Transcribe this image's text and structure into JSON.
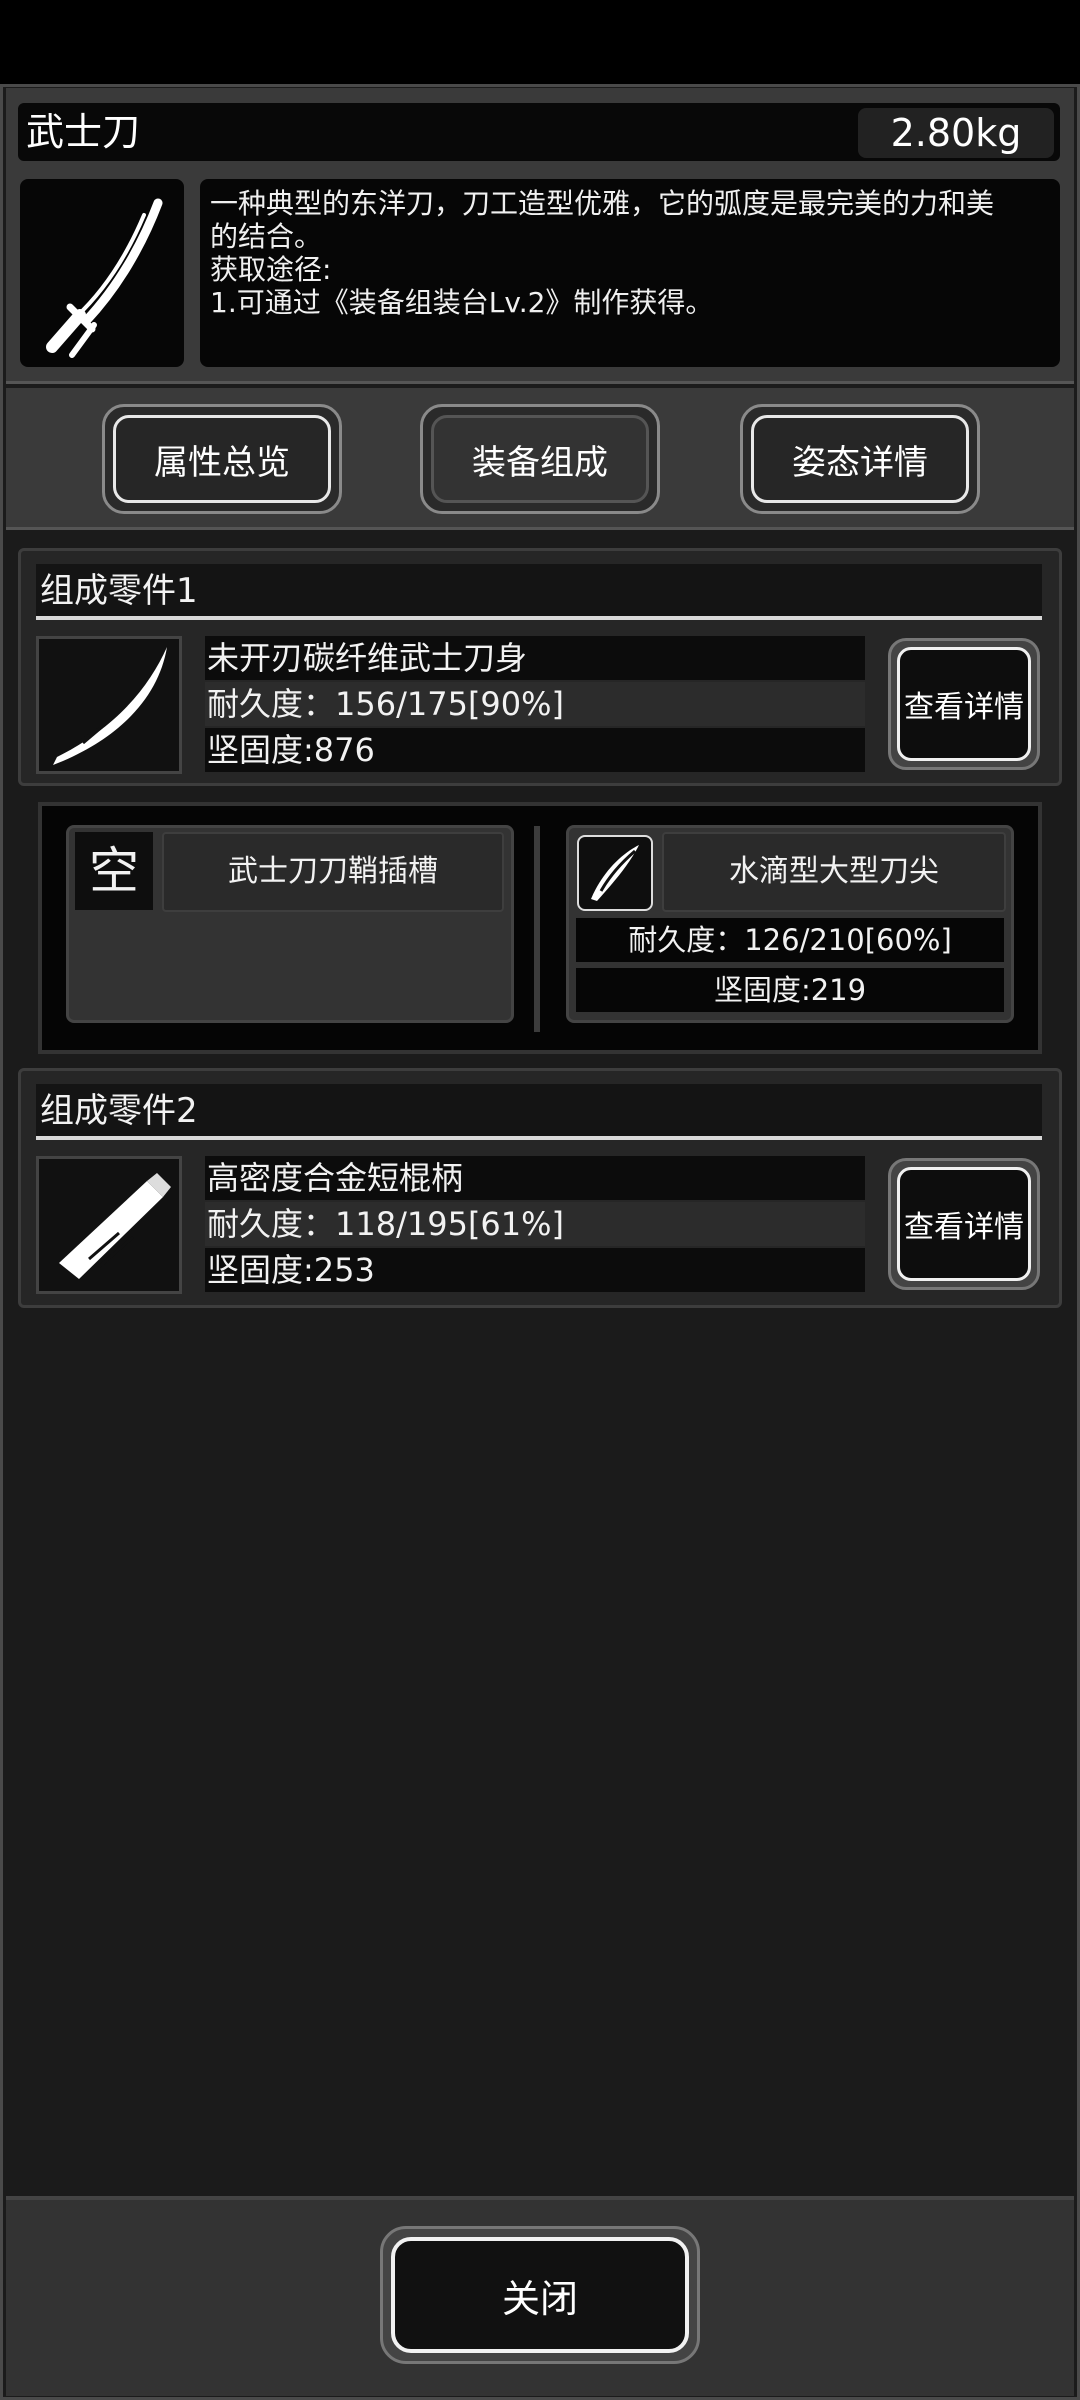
{
  "item": {
    "name": "武士刀",
    "weight": "2.80kg",
    "icon": "katana-icon",
    "description": [
      "一种典型的东洋刀，刀工造型优雅，它的弧度是最完美的力和美",
      "的结合。",
      "获取途径:",
      "1.可通过《装备组装台Lv.2》制作获得。"
    ]
  },
  "tabs": [
    {
      "label": "属性总览",
      "active": false
    },
    {
      "label": "装备组成",
      "active": true
    },
    {
      "label": "姿态详情",
      "active": false
    }
  ],
  "parts": [
    {
      "title": "组成零件1",
      "name": "未开刃碳纤维武士刀身",
      "durability": "耐久度：156/175[90%]",
      "firmness": "坚固度:876",
      "icon": "blade-icon",
      "button": "查看详情"
    },
    {
      "title": "组成零件2",
      "name": "高密度合金短棍柄",
      "durability": "耐久度：118/195[61%]",
      "firmness": "坚固度:253",
      "icon": "handle-icon",
      "button": "查看详情"
    }
  ],
  "sub_slots": {
    "left": {
      "empty_label": "空",
      "name": "武士刀刀鞘插槽"
    },
    "right": {
      "name": "水滴型大型刀尖",
      "durability": "耐久度：126/210[60%]",
      "firmness": "坚固度:219",
      "icon": "blade-tip-icon"
    }
  },
  "close_label": "关闭"
}
